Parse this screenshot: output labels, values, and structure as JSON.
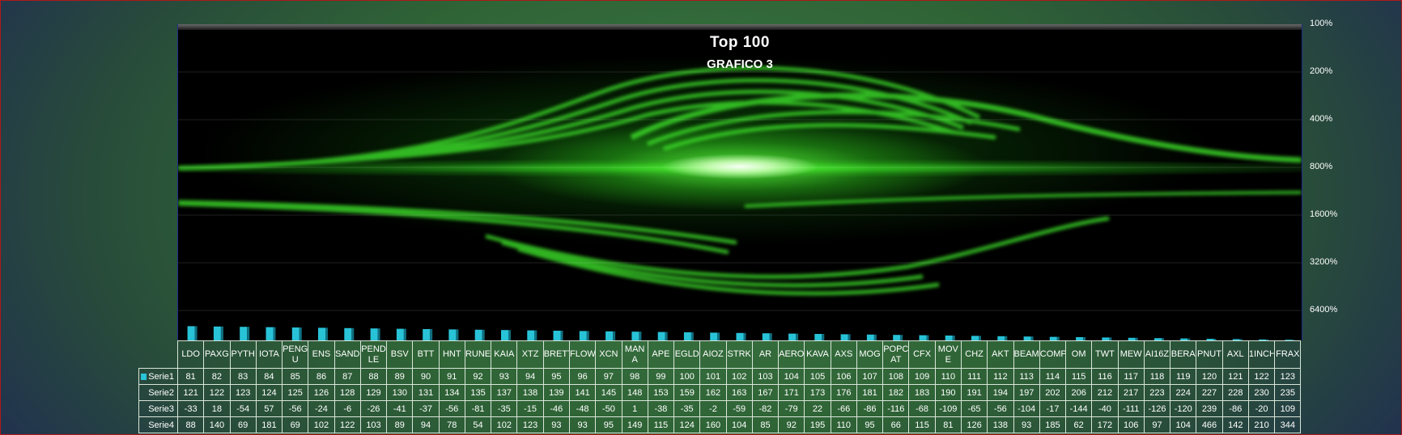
{
  "chart_data": {
    "type": "bar",
    "title": "Top 100",
    "subtitle": "GRAFICO 3",
    "y_axis": {
      "scale": "log2",
      "tick_labels": [
        "100%",
        "200%",
        "400%",
        "800%",
        "1600%",
        "3200%",
        "6400%"
      ],
      "position": "right"
    },
    "categories": [
      "LDO",
      "PAXG",
      "PYTH",
      "IOTA",
      "PENGU",
      "ENS",
      "SAND",
      "PENDLE",
      "BSV",
      "BTT",
      "HNT",
      "RUNE",
      "KAIA",
      "XTZ",
      "BRETT",
      "FLOW",
      "XCN",
      "MANA",
      "APE",
      "EGLD",
      "AIOZ",
      "STRK",
      "AR",
      "AERO",
      "KAVA",
      "AXS",
      "MOG",
      "POPCAT",
      "CFX",
      "MOVE",
      "CHZ",
      "AKT",
      "BEAM",
      "COMP",
      "OM",
      "TWT",
      "MEW",
      "AI16Z",
      "BERA",
      "PNUT",
      "AXL",
      "1INCH",
      "FRAX"
    ],
    "category_display": [
      "LDO",
      "PAXG",
      "PYTH",
      "IOTA",
      "PENG U",
      "ENS",
      "SAND",
      "PEND LE",
      "BSV",
      "BTT",
      "HNT",
      "RUNE",
      "KAIA",
      "XTZ",
      "BRETT",
      "FLOW",
      "XCN",
      "MAN A",
      "APE",
      "EGLD",
      "AIOZ",
      "STRK",
      "AR",
      "AERO",
      "KAVA",
      "AXS",
      "MOG",
      "POPC AT",
      "CFX",
      "MOV E",
      "CHZ",
      "AKT",
      "BEAM",
      "COMP",
      "OM",
      "TWT",
      "MEW",
      "AI16Z",
      "BERA",
      "PNUT",
      "AXL",
      "1INCH",
      "FRAX"
    ],
    "series": [
      {
        "name": "Serie1",
        "color": "#29c3d8",
        "values": [
          81,
          82,
          83,
          84,
          85,
          86,
          87,
          88,
          89,
          90,
          91,
          92,
          93,
          94,
          95,
          96,
          97,
          98,
          99,
          100,
          101,
          102,
          103,
          104,
          105,
          106,
          107,
          108,
          109,
          110,
          111,
          112,
          113,
          114,
          115,
          116,
          117,
          118,
          119,
          120,
          121,
          122,
          123
        ]
      },
      {
        "name": "Serie2",
        "values": [
          121,
          122,
          123,
          124,
          125,
          126,
          128,
          129,
          130,
          131,
          134,
          135,
          137,
          138,
          139,
          141,
          145,
          148,
          153,
          159,
          162,
          163,
          167,
          171,
          173,
          176,
          181,
          182,
          183,
          190,
          191,
          194,
          197,
          202,
          206,
          212,
          217,
          223,
          224,
          227,
          228,
          230,
          235
        ]
      },
      {
        "name": "Serie3",
        "values": [
          -33,
          18,
          -54,
          57,
          -56,
          -24,
          -6,
          -26,
          -41,
          -37,
          -56,
          -81,
          -35,
          -15,
          -46,
          -48,
          -50,
          1,
          -38,
          -35,
          -2,
          -59,
          -82,
          -79,
          22,
          -66,
          -86,
          -116,
          -68,
          -109,
          -65,
          -56,
          -104,
          -17,
          -144,
          -40,
          -111,
          -126,
          -120,
          239,
          -86,
          -20,
          109
        ]
      },
      {
        "name": "Serie4",
        "values": [
          88,
          140,
          69,
          181,
          69,
          102,
          122,
          103,
          89,
          94,
          78,
          54,
          102,
          123,
          93,
          93,
          95,
          149,
          115,
          124,
          160,
          104,
          85,
          92,
          195,
          110,
          95,
          66,
          115,
          81,
          126,
          138,
          93,
          185,
          62,
          172,
          106,
          97,
          104,
          466,
          142,
          210,
          344
        ]
      }
    ]
  }
}
